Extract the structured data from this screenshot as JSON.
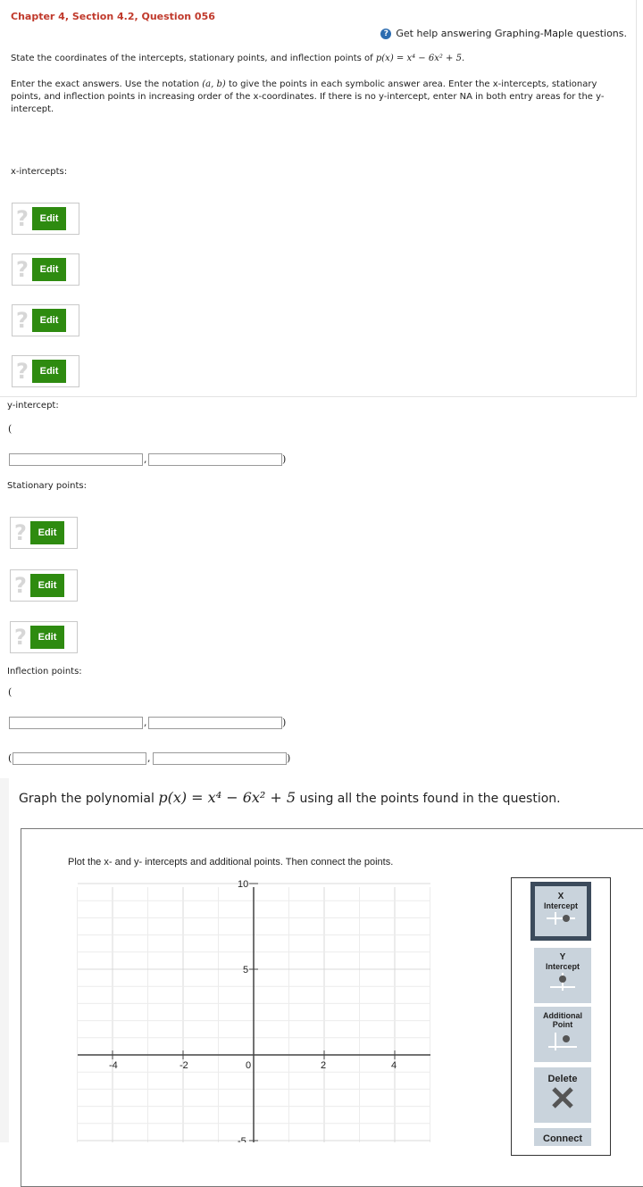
{
  "header": {
    "title": "Chapter 4, Section 4.2, Question 056",
    "help_link": "Get help answering Graphing-Maple questions."
  },
  "question": {
    "prompt_prefix": "State the coordinates of the intercepts, stationary points, and inflection points of",
    "prompt_function": "p(x) = x⁴ − 6x² + 5.",
    "instructions_1": "Enter the exact answers. Use the notation",
    "instructions_notation": "(a, b)",
    "instructions_2": "to give the points in each symbolic answer area. Enter the x-intercepts, stationary points, and inflection points in increasing order of the x-coordinates. If there is no y-intercept, enter NA in both entry areas for the y-intercept."
  },
  "sections": {
    "x_intercepts_label": "x-intercepts:",
    "y_intercept_label": "y-intercept:",
    "stationary_label": "Stationary points:",
    "inflection_label": "Inflection points:"
  },
  "edit_label": "Edit",
  "qmark": "?",
  "paren_open": "(",
  "paren_close": ")",
  "comma": ",",
  "graph": {
    "title_prefix": "Graph the polynomial",
    "title_function": "p(x) = x⁴ − 6x² + 5",
    "title_suffix": "using all the points found in the question.",
    "instruction": "Plot the x- and y- intercepts and additional points. Then connect the points.",
    "x_ticks": [
      "-4",
      "-2",
      "0",
      "2",
      "4"
    ],
    "y_ticks": [
      "10",
      "5",
      "-5"
    ]
  },
  "tools": {
    "x_intercept": [
      "X",
      "Intercept"
    ],
    "y_intercept": [
      "Y",
      "Intercept"
    ],
    "additional": [
      "Additional",
      "Point"
    ],
    "delete": "Delete",
    "connect": "Connect"
  }
}
